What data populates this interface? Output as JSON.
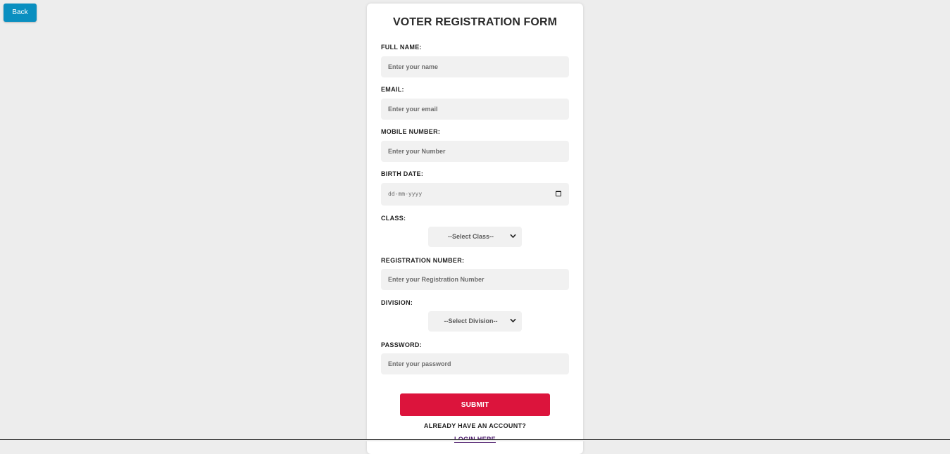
{
  "back_button": {
    "label": "Back"
  },
  "form": {
    "title": "VOTER REGISTRATION FORM",
    "full_name": {
      "label": "FULL NAME:",
      "placeholder": "Enter your name",
      "value": ""
    },
    "email": {
      "label": "EMAIL:",
      "placeholder": "Enter your email",
      "value": ""
    },
    "mobile": {
      "label": "MOBILE NUMBER:",
      "placeholder": "Enter your Number",
      "value": ""
    },
    "birth_date": {
      "label": "BIRTH DATE:",
      "placeholder": "dd-mm-yyyy",
      "icon": "calendar-icon"
    },
    "class": {
      "label": "CLASS:",
      "selected": "--Select Class--",
      "icon": "chevron-down-icon"
    },
    "registration_number": {
      "label": "REGISTRATION NUMBER:",
      "placeholder": "Enter your Registration Number",
      "value": ""
    },
    "division": {
      "label": "DIVISION:",
      "selected": "--Select Division--",
      "icon": "chevron-down-icon"
    },
    "password": {
      "label": "PASSWORD:",
      "placeholder": "Enter your password",
      "value": ""
    },
    "submit_label": "SUBMIT",
    "already_text": "ALREADY HAVE AN ACCOUNT?",
    "login_link": "LOGIN HERE"
  },
  "colors": {
    "background": "#ededed",
    "back_button": "#0a8fc0",
    "submit_button": "#dc143c",
    "input_background": "#f1f1f1"
  }
}
